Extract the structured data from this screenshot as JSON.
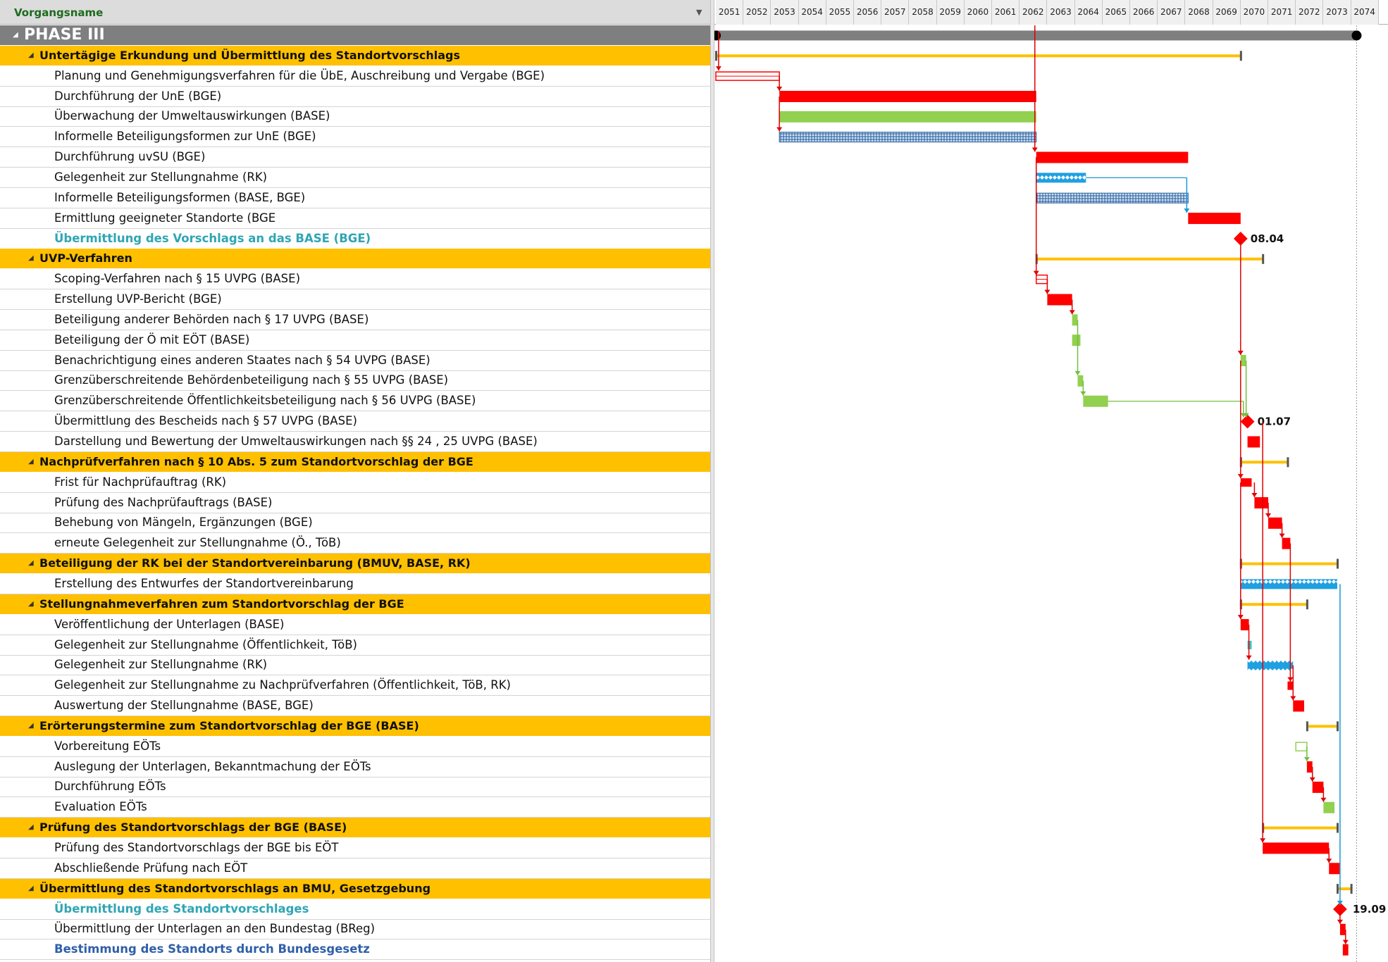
{
  "header": {
    "column_title": "Vorgangsname"
  },
  "years": [
    "2051",
    "2052",
    "2053",
    "2054",
    "2055",
    "2056",
    "2057",
    "2058",
    "2059",
    "2060",
    "2061",
    "2062",
    "2063",
    "2064",
    "2065",
    "2066",
    "2067",
    "2068",
    "2069",
    "2070",
    "2071",
    "2072",
    "2073",
    "2074"
  ],
  "colors": {
    "summary": "#ffc000",
    "critical": "#ff0000",
    "green": "#92d050",
    "blue": "#1fa0e0",
    "phase": "#7f7f7f",
    "link_red": "#e00000",
    "link_green": "#70c040",
    "link_blue": "#1a9ad8"
  },
  "rows": [
    {
      "type": "phase",
      "label": "PHASE III"
    },
    {
      "type": "sum",
      "label": "Untertägige Erkundung und Übermittlung des Standortvorschlags"
    },
    {
      "type": "task",
      "label": "Planung und Genehmigungsverfahren für die ÜbE, Auschreibung und Vergabe (BGE)"
    },
    {
      "type": "task",
      "label": "Durchführung der UnE (BGE)"
    },
    {
      "type": "task",
      "label": "Überwachung der Umweltauswirkungen (BASE)"
    },
    {
      "type": "task",
      "label": "Informelle Beteiligungsformen zur UnE (BGE)"
    },
    {
      "type": "task",
      "label": "Durchführung uvSU (BGE)"
    },
    {
      "type": "task",
      "label": "Gelegenheit zur Stellungnahme (RK)"
    },
    {
      "type": "task",
      "label": "Informelle Beteiligungsformen (BASE, BGE)"
    },
    {
      "type": "task",
      "label": "Ermittlung geeigneter Standorte (BGE"
    },
    {
      "type": "link",
      "label": "Übermittlung des Vorschlags an das BASE (BGE)"
    },
    {
      "type": "sum",
      "label": "UVP-Verfahren"
    },
    {
      "type": "task",
      "label": "Scoping-Verfahren nach § 15 UVPG (BASE)"
    },
    {
      "type": "task",
      "label": "Erstellung UVP-Bericht (BGE)"
    },
    {
      "type": "task",
      "label": "Beteiligung anderer Behörden nach § 17 UVPG (BASE)"
    },
    {
      "type": "task",
      "label": "Beteiligung der Ö mit EÖT (BASE)"
    },
    {
      "type": "task",
      "label": "Benachrichtigung eines anderen Staates nach § 54 UVPG (BASE)"
    },
    {
      "type": "task",
      "label": "Grenzüberschreitende Behördenbeteiligung nach § 55 UVPG (BASE)"
    },
    {
      "type": "task",
      "label": "Grenzüberschreitende Öffentlichkeitsbeteiligung nach § 56 UVPG (BASE)"
    },
    {
      "type": "task",
      "label": "Übermittlung des Bescheids nach § 57 UVPG (BASE)"
    },
    {
      "type": "task",
      "label": "Darstellung und Bewertung der Umweltauswirkungen nach §§ 24 , 25 UVPG (BASE)"
    },
    {
      "type": "sum",
      "label": "Nachprüfverfahren nach § 10 Abs. 5 zum Standortvorschlag der BGE"
    },
    {
      "type": "task",
      "label": "Frist für Nachprüfauftrag (RK)"
    },
    {
      "type": "task",
      "label": "Prüfung des Nachprüfauftrags (BASE)"
    },
    {
      "type": "task",
      "label": "Behebung von Mängeln, Ergänzungen (BGE)"
    },
    {
      "type": "task",
      "label": "erneute Gelegenheit zur Stellungnahme (Ö., TöB)"
    },
    {
      "type": "sum",
      "label": "Beteiligung der RK bei der Standortvereinbarung (BMUV, BASE, RK)"
    },
    {
      "type": "task",
      "label": "Erstellung des Entwurfes der Standortvereinbarung"
    },
    {
      "type": "sum",
      "label": "Stellungnahmeverfahren zum Standortvorschlag der BGE"
    },
    {
      "type": "task",
      "label": "Veröffentlichung der Unterlagen (BASE)"
    },
    {
      "type": "task",
      "label": "Gelegenheit zur Stellungnahme (Öffentlichkeit, TöB)"
    },
    {
      "type": "task",
      "label": "Gelegenheit zur Stellungnahme (RK)"
    },
    {
      "type": "task",
      "label": "Gelegenheit zur Stellungnahme zu Nachprüfverfahren (Öffentlichkeit, TöB, RK)"
    },
    {
      "type": "task",
      "label": "Auswertung der Stellungnahme (BASE, BGE)"
    },
    {
      "type": "sum",
      "label": "Erörterungstermine zum Standortvorschlag der BGE (BASE)"
    },
    {
      "type": "task",
      "label": "Vorbereitung EÖTs"
    },
    {
      "type": "task",
      "label": "Auslegung der Unterlagen, Bekanntmachung der EÖTs"
    },
    {
      "type": "task",
      "label": "Durchführung EÖTs"
    },
    {
      "type": "task",
      "label": "Evaluation EÖTs"
    },
    {
      "type": "sum",
      "label": "Prüfung des Standortvorschlags der BGE (BASE)"
    },
    {
      "type": "task",
      "label": "Prüfung des Standortvorschlags der BGE bis EÖT"
    },
    {
      "type": "task",
      "label": "Abschließende Prüfung nach EÖT"
    },
    {
      "type": "sum",
      "label": "Übermittlung des Standortvorschlags an BMU, Gesetzgebung"
    },
    {
      "type": "link",
      "label": "Übermittlung des Standortvorschlages"
    },
    {
      "type": "task",
      "label": "Übermittlung der Unterlagen an den Bundestag (BReg)"
    },
    {
      "type": "blue",
      "label": "Bestimmung des Standorts durch Bundesgesetz"
    }
  ],
  "gantt": {
    "milestone_labels": [
      {
        "row": 10,
        "text": "08.04",
        "x": 2070.0
      },
      {
        "row": 19,
        "text": "01.07",
        "x": 2070.25
      },
      {
        "row": 43,
        "text": "19.09",
        "x": 2073.7
      }
    ],
    "bars": [
      {
        "row": 0,
        "kind": "phase",
        "start": 2051.0,
        "end": 2074.2
      },
      {
        "row": 1,
        "kind": "summary",
        "start": 2051.0,
        "end": 2070.0
      },
      {
        "row": 2,
        "kind": "red-hollow",
        "start": 2051.0,
        "end": 2053.3
      },
      {
        "row": 3,
        "kind": "red",
        "start": 2053.3,
        "end": 2062.6
      },
      {
        "row": 4,
        "kind": "green",
        "start": 2053.3,
        "end": 2062.6
      },
      {
        "row": 5,
        "kind": "blue-hatch",
        "start": 2053.3,
        "end": 2062.6
      },
      {
        "row": 6,
        "kind": "red",
        "start": 2062.6,
        "end": 2068.1
      },
      {
        "row": 7,
        "kind": "blue",
        "start": 2062.6,
        "end": 2064.4
      },
      {
        "row": 8,
        "kind": "blue-hatch",
        "start": 2062.6,
        "end": 2068.1
      },
      {
        "row": 9,
        "kind": "red",
        "start": 2068.1,
        "end": 2070.0
      },
      {
        "row": 10,
        "kind": "milestone",
        "start": 2070.0,
        "end": 2070.0
      },
      {
        "row": 11,
        "kind": "summary",
        "start": 2062.6,
        "end": 2070.8
      },
      {
        "row": 12,
        "kind": "red-hollow",
        "start": 2062.6,
        "end": 2063.0
      },
      {
        "row": 13,
        "kind": "red",
        "start": 2063.0,
        "end": 2063.9
      },
      {
        "row": 14,
        "kind": "green",
        "start": 2063.9,
        "end": 2064.1
      },
      {
        "row": 15,
        "kind": "green",
        "start": 2063.9,
        "end": 2064.2
      },
      {
        "row": 16,
        "kind": "green",
        "start": 2070.0,
        "end": 2070.2
      },
      {
        "row": 17,
        "kind": "green",
        "start": 2064.1,
        "end": 2064.3
      },
      {
        "row": 18,
        "kind": "green",
        "start": 2064.3,
        "end": 2065.2
      },
      {
        "row": 19,
        "kind": "milestone",
        "start": 2070.25,
        "end": 2070.25
      },
      {
        "row": 20,
        "kind": "red",
        "start": 2070.25,
        "end": 2070.7
      },
      {
        "row": 21,
        "kind": "summary",
        "start": 2070.0,
        "end": 2071.7
      },
      {
        "row": 22,
        "kind": "red-jag",
        "start": 2070.0,
        "end": 2070.4
      },
      {
        "row": 23,
        "kind": "red",
        "start": 2070.5,
        "end": 2071.0
      },
      {
        "row": 24,
        "kind": "red",
        "start": 2071.0,
        "end": 2071.5
      },
      {
        "row": 25,
        "kind": "red",
        "start": 2071.5,
        "end": 2071.8
      },
      {
        "row": 26,
        "kind": "summary",
        "start": 2070.0,
        "end": 2073.5
      },
      {
        "row": 27,
        "kind": "blue",
        "start": 2070.0,
        "end": 2073.5
      },
      {
        "row": 28,
        "kind": "summary",
        "start": 2070.0,
        "end": 2072.4
      },
      {
        "row": 29,
        "kind": "red",
        "start": 2070.0,
        "end": 2070.3
      },
      {
        "row": 30,
        "kind": "teal",
        "start": 2070.25,
        "end": 2070.4
      },
      {
        "row": 31,
        "kind": "blue",
        "start": 2070.25,
        "end": 2071.9
      },
      {
        "row": 32,
        "kind": "red-jag",
        "start": 2071.7,
        "end": 2071.9
      },
      {
        "row": 33,
        "kind": "red",
        "start": 2071.9,
        "end": 2072.3
      },
      {
        "row": 34,
        "kind": "summary",
        "start": 2072.4,
        "end": 2073.5
      },
      {
        "row": 35,
        "kind": "green-hollow",
        "start": 2072.0,
        "end": 2072.4
      },
      {
        "row": 36,
        "kind": "red",
        "start": 2072.4,
        "end": 2072.6
      },
      {
        "row": 37,
        "kind": "red",
        "start": 2072.6,
        "end": 2073.0
      },
      {
        "row": 38,
        "kind": "green",
        "start": 2073.0,
        "end": 2073.4
      },
      {
        "row": 39,
        "kind": "summary",
        "start": 2070.8,
        "end": 2073.5
      },
      {
        "row": 40,
        "kind": "red",
        "start": 2070.8,
        "end": 2073.2
      },
      {
        "row": 41,
        "kind": "red",
        "start": 2073.2,
        "end": 2073.6
      },
      {
        "row": 42,
        "kind": "summary",
        "start": 2073.5,
        "end": 2074.0
      },
      {
        "row": 43,
        "kind": "milestone",
        "start": 2073.6,
        "end": 2073.6
      },
      {
        "row": 44,
        "kind": "red",
        "start": 2073.6,
        "end": 2073.8
      },
      {
        "row": 45,
        "kind": "red",
        "start": 2073.7,
        "end": 2073.9
      }
    ]
  }
}
